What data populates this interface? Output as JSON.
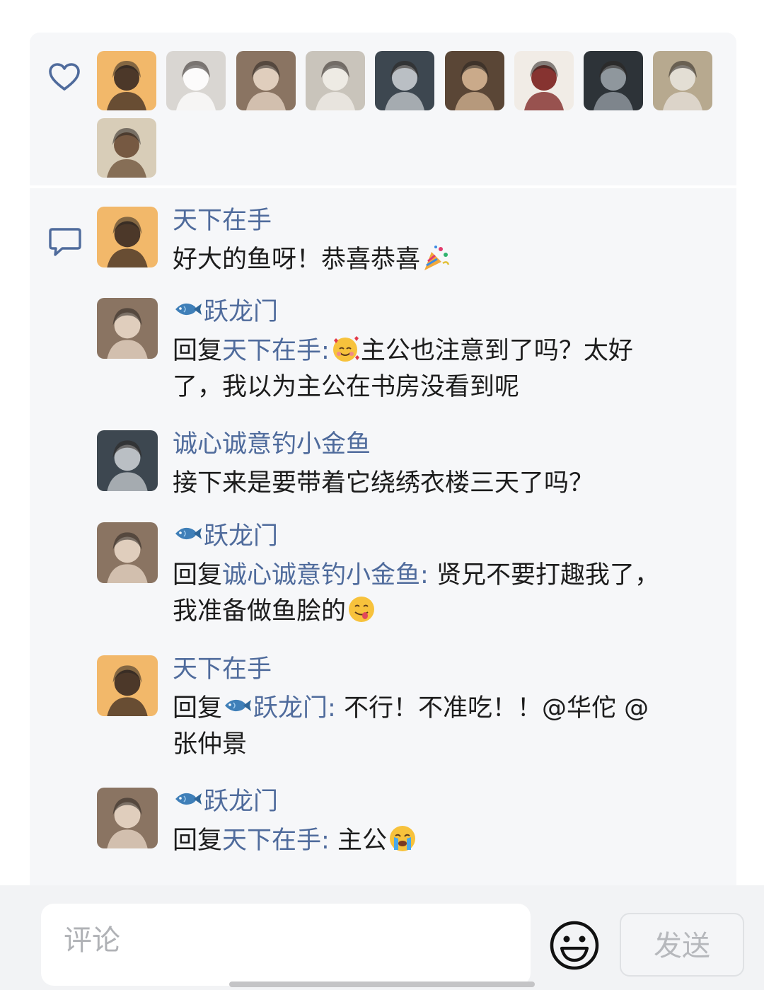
{
  "likes": {
    "avatars": [
      {
        "name": "天下在手",
        "bg": "#f2b86a",
        "fg": "#3a2a22"
      },
      {
        "name": "white-bird",
        "bg": "#d9d6d2",
        "fg": "#ffffff"
      },
      {
        "name": "跃龙门",
        "bg": "#8a7462",
        "fg": "#e9d8c8"
      },
      {
        "name": "white-hair",
        "bg": "#c9c4bb",
        "fg": "#f2efe9"
      },
      {
        "name": "诚心诚意钓小金鱼",
        "bg": "#3d4750",
        "fg": "#c8ccd0"
      },
      {
        "name": "dark-hair-man",
        "bg": "#5a4636",
        "fg": "#d6b594"
      },
      {
        "name": "red-robe",
        "bg": "#f1ece6",
        "fg": "#7a1f1c"
      },
      {
        "name": "black-hair",
        "bg": "#2d3338",
        "fg": "#9aa2a8"
      },
      {
        "name": "silver-hair",
        "bg": "#b7a98f",
        "fg": "#e8e3dc"
      },
      {
        "name": "warrior",
        "bg": "#d8cdb8",
        "fg": "#6b4d35"
      }
    ]
  },
  "comments": [
    {
      "author": "天下在手",
      "fish": false,
      "reply_prefix": "",
      "reply_to": "",
      "text": "好大的鱼呀！恭喜恭喜",
      "emoji": "party-popper",
      "text_after": "",
      "avatar": {
        "bg": "#f2b86a",
        "fg": "#3a2a22"
      }
    },
    {
      "author": "跃龙门",
      "fish": true,
      "reply_prefix": "回复",
      "reply_to": "天下在手:",
      "text": "",
      "emoji": "smiling-face-with-hearts",
      "text_after": "主公也注意到了吗？太好了，我以为主公在书房没看到呢",
      "avatar": {
        "bg": "#8a7462",
        "fg": "#e9d8c8"
      }
    },
    {
      "author": "诚心诚意钓小金鱼",
      "fish": false,
      "reply_prefix": "",
      "reply_to": "",
      "text": "接下来是要带着它绕绣衣楼三天了吗？",
      "emoji": "",
      "text_after": "",
      "avatar": {
        "bg": "#3d4750",
        "fg": "#c8ccd0"
      }
    },
    {
      "author": "跃龙门",
      "fish": true,
      "reply_prefix": "回复",
      "reply_to": "诚心诚意钓小金鱼:",
      "text": " 贤兄不要打趣我了，我准备做鱼脍的",
      "emoji": "yum-face",
      "text_after": "",
      "avatar": {
        "bg": "#8a7462",
        "fg": "#e9d8c8"
      }
    },
    {
      "author": "天下在手",
      "fish": false,
      "reply_prefix": "回复",
      "reply_to_fish": true,
      "reply_to": "跃龙门:",
      "text": " 不行！不准吃！！@华佗 @张仲景",
      "emoji": "",
      "text_after": "",
      "avatar": {
        "bg": "#f2b86a",
        "fg": "#3a2a22"
      }
    },
    {
      "author": "跃龙门",
      "fish": true,
      "reply_prefix": "回复",
      "reply_to": "天下在手:",
      "text": " 主公",
      "emoji": "loudly-crying-face",
      "text_after": "",
      "avatar": {
        "bg": "#8a7462",
        "fg": "#e9d8c8"
      }
    }
  ],
  "composer": {
    "placeholder": "评论",
    "send_label": "发送",
    "emoji_icon": "emoji-face-icon"
  },
  "colors": {
    "link": "#4f6b9c",
    "panel": "#f6f7f9",
    "text": "#1c1c1c"
  }
}
